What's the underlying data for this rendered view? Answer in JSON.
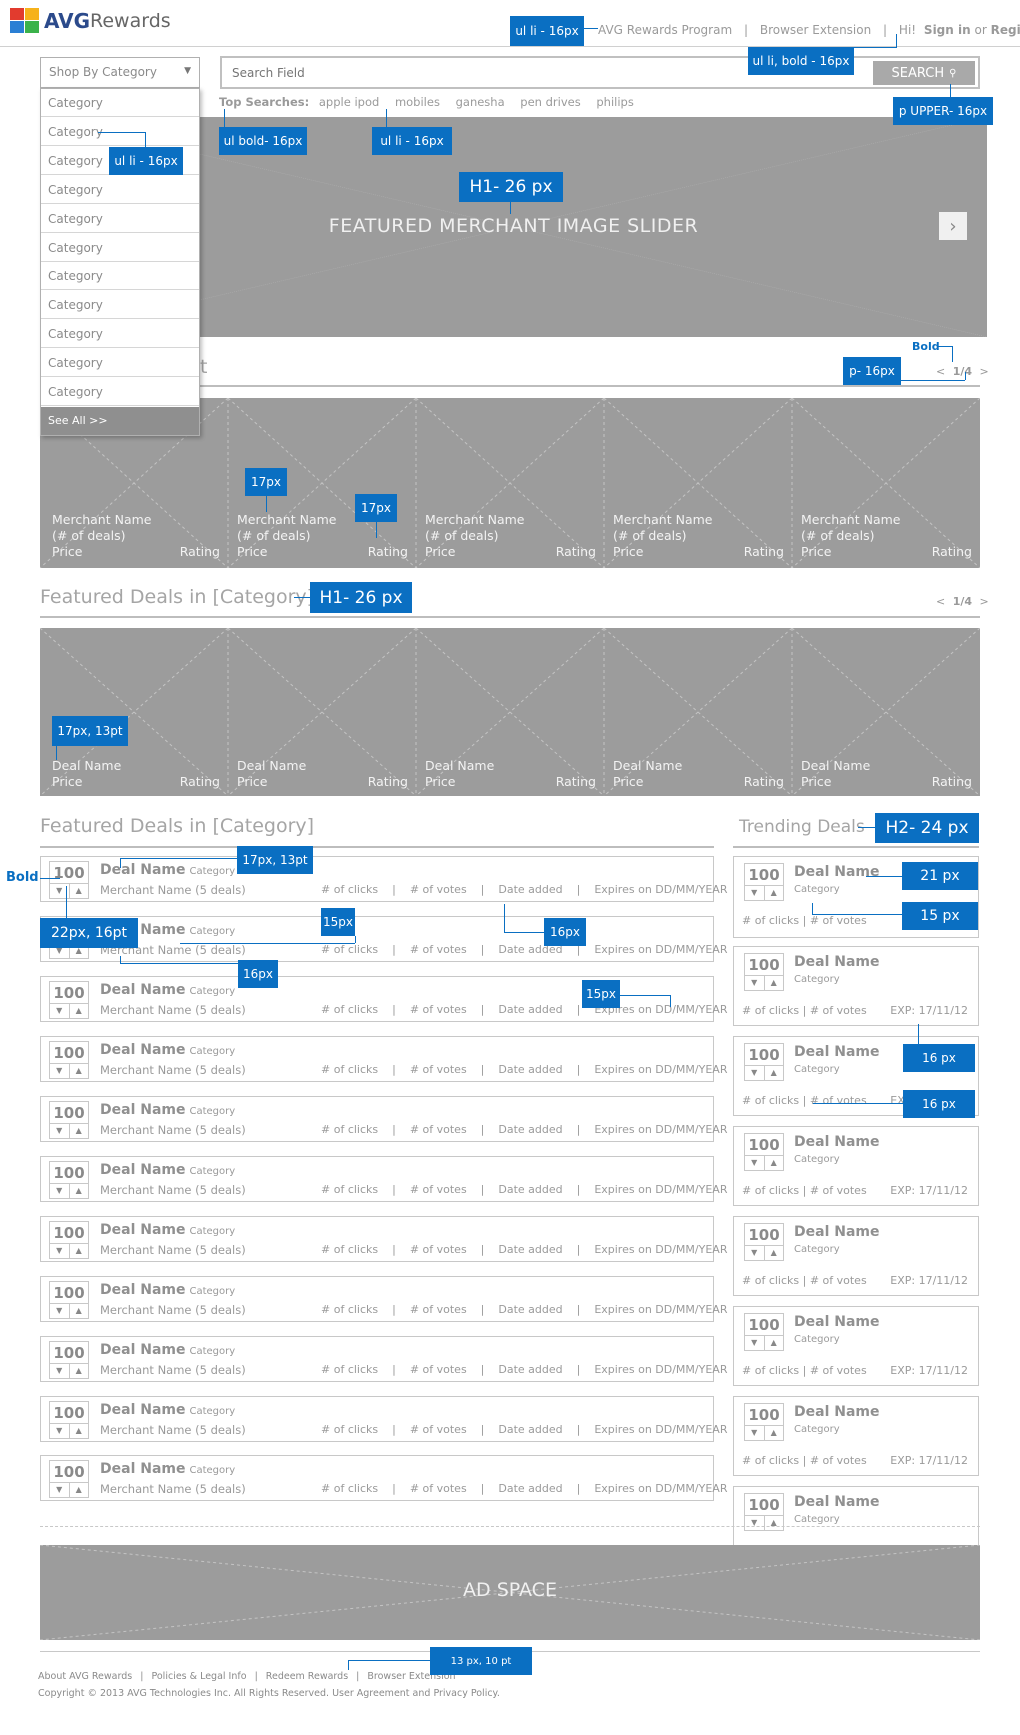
{
  "header": {
    "logo_text": "AVG",
    "logo_sub": "Rewards",
    "nav": [
      "AVG Rewards Program",
      "Browser Extension"
    ],
    "greeting": "Hi!",
    "sign_in": "Sign in",
    "or": "or",
    "register": "Register"
  },
  "category_menu": {
    "label": "Shop By Category",
    "items": [
      "Category",
      "Category",
      "Category",
      "Category",
      "Category",
      "Category",
      "Category",
      "Category",
      "Category",
      "Category",
      "Category"
    ],
    "see_all": "See All >>"
  },
  "search": {
    "placeholder": "Search Field",
    "button": "SEARCH",
    "top_label": "Top Searches:",
    "top_terms": [
      "apple ipod",
      "mobiles",
      "ganesha",
      "pen drives",
      "philips"
    ]
  },
  "slider": {
    "title": "FEATURED MERCHANT IMAGE SLIDER"
  },
  "merchants": {
    "heading_fragment": "t",
    "pager": "1/4",
    "items": [
      {
        "name": "Merchant Name",
        "deals": "(# of deals)",
        "price": "Price",
        "rating": "Rating"
      },
      {
        "name": "Merchant Name",
        "deals": "(# of deals)",
        "price": "Price",
        "rating": "Rating"
      },
      {
        "name": "Merchant Name",
        "deals": "(# of deals)",
        "price": "Price",
        "rating": "Rating"
      },
      {
        "name": "Merchant Name",
        "deals": "(# of deals)",
        "price": "Price",
        "rating": "Rating"
      },
      {
        "name": "Merchant Name",
        "deals": "(# of deals)",
        "price": "Price",
        "rating": "Rating"
      }
    ]
  },
  "featured_deals": {
    "heading": "Featured Deals in [Category]",
    "pager": "1/4",
    "items": [
      {
        "name": "Deal Name",
        "price": "Price",
        "rating": "Rating"
      },
      {
        "name": "Deal Name",
        "price": "Price",
        "rating": "Rating"
      },
      {
        "name": "Deal Name",
        "price": "Price",
        "rating": "Rating"
      },
      {
        "name": "Deal Name",
        "price": "Price",
        "rating": "Rating"
      },
      {
        "name": "Deal Name",
        "price": "Price",
        "rating": "Rating"
      }
    ]
  },
  "deal_list": {
    "heading": "Featured Deals in [Category]",
    "row": {
      "votes": "100",
      "name": "Deal Name",
      "category": "Category",
      "merchant": "Merchant Name (5 deals)",
      "clicks": "# of clicks",
      "votes_label": "# of votes",
      "date": "Date added",
      "expires": "Expires on DD/MM/YEAR"
    },
    "count": 11
  },
  "trending": {
    "heading": "Trending Deals",
    "card": {
      "votes": "100",
      "name": "Deal Name",
      "category": "Category",
      "stats": "# of clicks | # of votes",
      "exp": "EXP: 17/11/12"
    },
    "count": 8
  },
  "ad": {
    "label": "AD SPACE"
  },
  "footer": {
    "links": [
      "About AVG Rewards",
      "Policies & Legal Info",
      "Redeem Rewards",
      "Browser Extension"
    ],
    "copyright": "Copyright © 2013 AVG Technologies Inc. All Rights Reserved. User Agreement and Privacy Policy."
  },
  "annotations": {
    "nav": "ul li - 16px",
    "nav_bold": "ul li, bold - 16px",
    "search_btn": "p UPPER- 16px",
    "top_bold": "ul bold- 16px",
    "top_li": "ul li - 16px",
    "cat_li": "ul li - 16px",
    "slider_h1": "H1- 26 px",
    "pager_bold": "Bold",
    "pager_p": "p- 16px",
    "merchant_17a": "17px",
    "merchant_17b": "17px",
    "featured_h1": "H1- 26 px",
    "deal_17": "17px, 13pt",
    "list_bold": "Bold",
    "list_17": "17px, 13pt",
    "list_22": "22px, 16pt",
    "list_15a": "15px",
    "list_16a": "16px",
    "list_16b": "16px",
    "list_15b": "15px",
    "trend_h2": "H2- 24 px",
    "trend_21": "21 px",
    "trend_15": "15 px",
    "trend_16a": "16 px",
    "trend_16b": "16 px",
    "footer": "13 px, 10 pt"
  },
  "colors": {
    "annotation": "#0a6fc2",
    "placeholder_fill": "#9c9c9c",
    "logo_red": "#d42a2a"
  }
}
